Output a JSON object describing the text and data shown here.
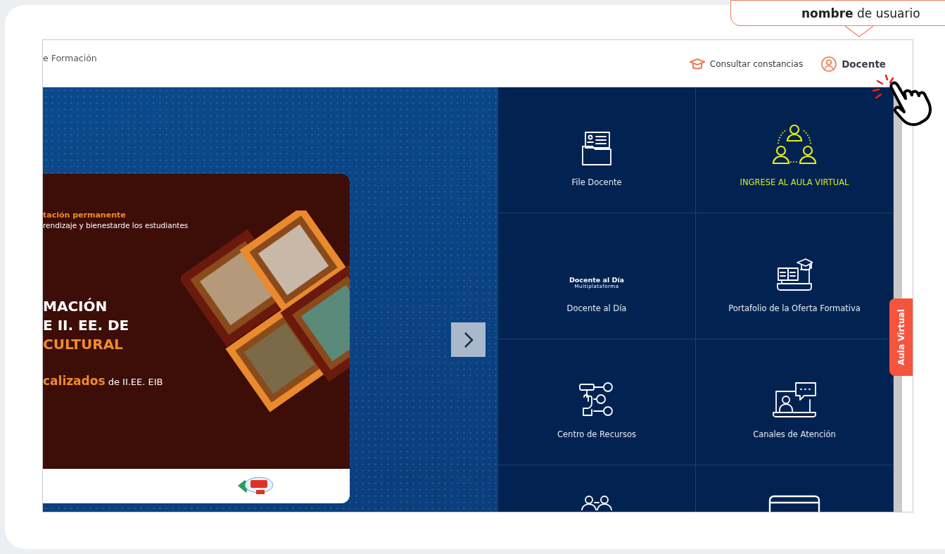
{
  "callout": {
    "text": "**nombre** de usuario"
  },
  "header": {
    "title": "e Formación",
    "links": [
      {
        "kind": "cap",
        "label": "Consultar constancias"
      },
      {
        "kind": "user",
        "label": "Docente"
      }
    ]
  },
  "banner": {
    "kicker": "tación permanente",
    "subtitle": "rendizaje y bienestarde los estudiantes",
    "headline": [
      {
        "text": "MACIÓN",
        "accent": false
      },
      {
        "text": "E II. EE. DE",
        "accent": false
      },
      {
        "text": "CULTURAL",
        "accent": true
      }
    ],
    "tagline": "**calizados** de II.EE. EIB"
  },
  "tiles": [
    {
      "kind": "folder",
      "label": "File Docente",
      "highlighted": false
    },
    {
      "kind": "group",
      "label": "INGRESE AL AULA VIRTUAL",
      "highlighted": true
    },
    {
      "kind": "logo",
      "label": "Docente al Día",
      "logo": "Docente al Día",
      "logo_sub": "Multiplataforma",
      "highlighted": false
    },
    {
      "kind": "laptop-books",
      "label": "Portafolio de la Oferta Formativa",
      "highlighted": false
    },
    {
      "kind": "network",
      "label": "Centro de Recursos",
      "highlighted": false
    },
    {
      "kind": "video-chat",
      "label": "Canales de Atención",
      "highlighted": false
    },
    {
      "kind": "pair",
      "highlighted": false
    },
    {
      "kind": "window",
      "highlighted": false
    }
  ],
  "side_tab": {
    "label": "Aula Virtual"
  }
}
